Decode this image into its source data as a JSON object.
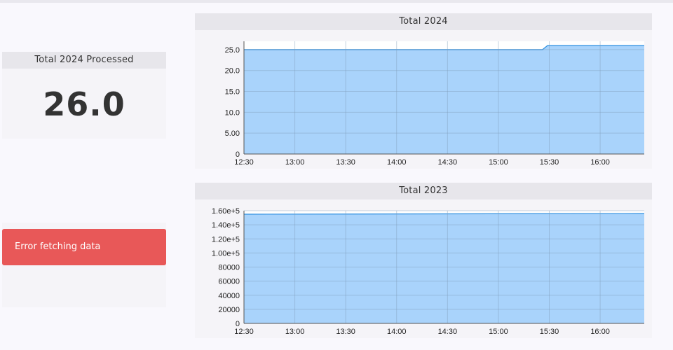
{
  "stat_card": {
    "title": "Total 2024 Processed",
    "value": "26.0"
  },
  "error_card": {
    "message": "Error fetching data"
  },
  "colors": {
    "fill": "#a9d3fb",
    "line": "#2e8fe0",
    "grid": "#7f9cb8",
    "error": "#e85858"
  },
  "chart_data": [
    {
      "type": "area",
      "title": "Total 2024",
      "x_ticks": [
        "12:30",
        "13:00",
        "13:30",
        "14:00",
        "14:30",
        "15:00",
        "15:30",
        "16:00"
      ],
      "y_ticks": [
        "0",
        "5.00",
        "10.0",
        "15.0",
        "20.0",
        "25.0"
      ],
      "ylim": [
        0,
        27
      ],
      "series": [
        {
          "x": [
            "12:30",
            "15:26",
            "15:29",
            "16:25"
          ],
          "values": [
            25,
            25,
            26,
            26
          ]
        }
      ]
    },
    {
      "type": "area",
      "title": "Total 2023",
      "x_ticks": [
        "12:30",
        "13:00",
        "13:30",
        "14:00",
        "14:30",
        "15:00",
        "15:30",
        "16:00"
      ],
      "y_ticks": [
        "0",
        "20000",
        "40000",
        "60000",
        "80000",
        "1.00e+5",
        "1.20e+5",
        "1.40e+5",
        "1.60e+5"
      ],
      "ylim": [
        0,
        160000
      ],
      "series": [
        {
          "x": [
            "12:30",
            "16:25"
          ],
          "values": [
            155000,
            156000
          ]
        }
      ]
    }
  ]
}
